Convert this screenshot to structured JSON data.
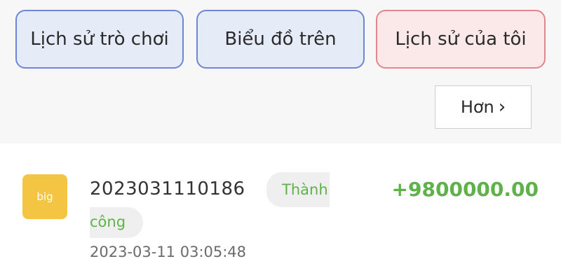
{
  "tabs": {
    "game_history": "Lịch sử trò chơi",
    "chart": "Biểu đồ trên",
    "my_history": "Lịch sử của tôi"
  },
  "more_button": {
    "label": "Hơn",
    "icon": "chevron-right-icon"
  },
  "record": {
    "badge": "big",
    "order_id": "2023031110186",
    "status_line1": "Thành",
    "status_line2": "công",
    "amount": "+9800000.00",
    "timestamp": "2023-03-11 03:05:48"
  },
  "colors": {
    "success": "#5fb24a",
    "badge": "#f4c542",
    "tab_blue_border": "#6f86d6",
    "tab_red_border": "#e0868c"
  }
}
